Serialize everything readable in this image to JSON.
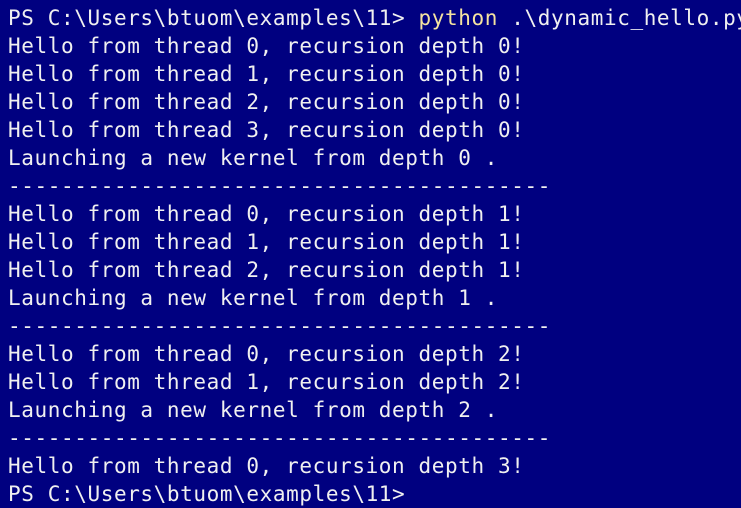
{
  "terminal": {
    "colors": {
      "background": "#000080",
      "text": "#f0f0f0",
      "command": "#f4e3a0"
    },
    "command_line": {
      "prompt": "PS C:\\Users\\btuom\\examples\\11> ",
      "command": "python",
      "argument": " .\\dynamic_hello.py"
    },
    "output": [
      "Hello from thread 0, recursion depth 0!",
      "Hello from thread 1, recursion depth 0!",
      "Hello from thread 2, recursion depth 0!",
      "Hello from thread 3, recursion depth 0!",
      "Launching a new kernel from depth 0 .",
      "-----------------------------------------",
      "Hello from thread 0, recursion depth 1!",
      "Hello from thread 1, recursion depth 1!",
      "Hello from thread 2, recursion depth 1!",
      "Launching a new kernel from depth 1 .",
      "-----------------------------------------",
      "Hello from thread 0, recursion depth 2!",
      "Hello from thread 1, recursion depth 2!",
      "Launching a new kernel from depth 2 .",
      "-----------------------------------------",
      "Hello from thread 0, recursion depth 3!"
    ],
    "final_prompt": "PS C:\\Users\\btuom\\examples\\11>"
  }
}
